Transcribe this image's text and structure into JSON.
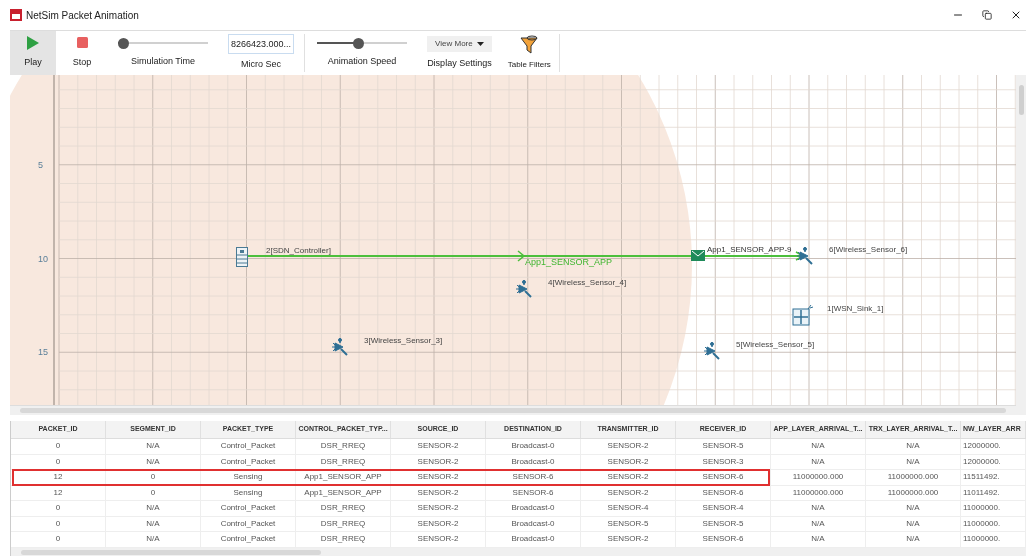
{
  "window": {
    "title": "NetSim Packet Animation"
  },
  "toolbar": {
    "play": {
      "label": "Play",
      "selected": true
    },
    "stop": {
      "label": "Stop",
      "selected": false
    },
    "simulation_time": {
      "label": "Simulation Time",
      "level": 0.05
    },
    "time_field": {
      "value": "8266423.000...",
      "label": "Micro Sec"
    },
    "animation_speed": {
      "label": "Animation Speed",
      "level": 0.45
    },
    "display_settings": {
      "button": "View More",
      "label": "Display Settings"
    },
    "table_filters": {
      "label": "Table Filters"
    }
  },
  "canvas": {
    "y_axis_labels": [
      "5",
      "10",
      "15"
    ],
    "nodes": [
      {
        "label": "2[SDN_Controller]",
        "kind": "controller"
      },
      {
        "label": "6[Wireless_Sensor_6]",
        "kind": "sensor"
      },
      {
        "label": "4[Wireless_Sensor_4]",
        "kind": "sensor"
      },
      {
        "label": "1[WSN_Sink_1]",
        "kind": "sink"
      },
      {
        "label": "3[Wireless_Sensor_3]",
        "kind": "sensor"
      },
      {
        "label": "5[Wireless_Sensor_5]",
        "kind": "sensor"
      }
    ],
    "link_label": "App1_SENSOR_APP",
    "packet_label": "App1_SENSOR_APP-9"
  },
  "table": {
    "columns": [
      "PACKET_ID",
      "SEGMENT_ID",
      "PACKET_TYPE",
      "CONTROL_PACKET_TYP...",
      "SOURCE_ID",
      "DESTINATION_ID",
      "TRANSMITTER_ID",
      "RECEIVER_ID",
      "APP_LAYER_ARRIVAL_T...",
      "TRX_LAYER_ARRIVAL_T...",
      "NW_LAYER_ARR"
    ],
    "rows": [
      {
        "highlighted": false,
        "cells": [
          "0",
          "N/A",
          "Control_Packet",
          "DSR_RREQ",
          "SENSOR-2",
          "Broadcast-0",
          "SENSOR-2",
          "SENSOR-5",
          "N/A",
          "N/A",
          "12000000."
        ]
      },
      {
        "highlighted": false,
        "cells": [
          "0",
          "N/A",
          "Control_Packet",
          "DSR_RREQ",
          "SENSOR-2",
          "Broadcast-0",
          "SENSOR-2",
          "SENSOR-3",
          "N/A",
          "N/A",
          "12000000."
        ]
      },
      {
        "highlighted": true,
        "cells": [
          "12",
          "0",
          "Sensing",
          "App1_SENSOR_APP",
          "SENSOR-2",
          "SENSOR-6",
          "SENSOR-2",
          "SENSOR-6",
          "11000000.000",
          "11000000.000",
          "11511492."
        ]
      },
      {
        "highlighted": false,
        "cells": [
          "12",
          "0",
          "Sensing",
          "App1_SENSOR_APP",
          "SENSOR-2",
          "SENSOR-6",
          "SENSOR-2",
          "SENSOR-6",
          "11000000.000",
          "11000000.000",
          "11011492."
        ]
      },
      {
        "highlighted": false,
        "cells": [
          "0",
          "N/A",
          "Control_Packet",
          "DSR_RREQ",
          "SENSOR-2",
          "Broadcast-0",
          "SENSOR-4",
          "SENSOR-4",
          "N/A",
          "N/A",
          "11000000."
        ]
      },
      {
        "highlighted": false,
        "cells": [
          "0",
          "N/A",
          "Control_Packet",
          "DSR_RREQ",
          "SENSOR-2",
          "Broadcast-0",
          "SENSOR-5",
          "SENSOR-5",
          "N/A",
          "N/A",
          "11000000."
        ]
      },
      {
        "highlighted": false,
        "cells": [
          "0",
          "N/A",
          "Control_Packet",
          "DSR_RREQ",
          "SENSOR-2",
          "Broadcast-0",
          "SENSOR-2",
          "SENSOR-6",
          "N/A",
          "N/A",
          "11000000."
        ]
      }
    ]
  }
}
